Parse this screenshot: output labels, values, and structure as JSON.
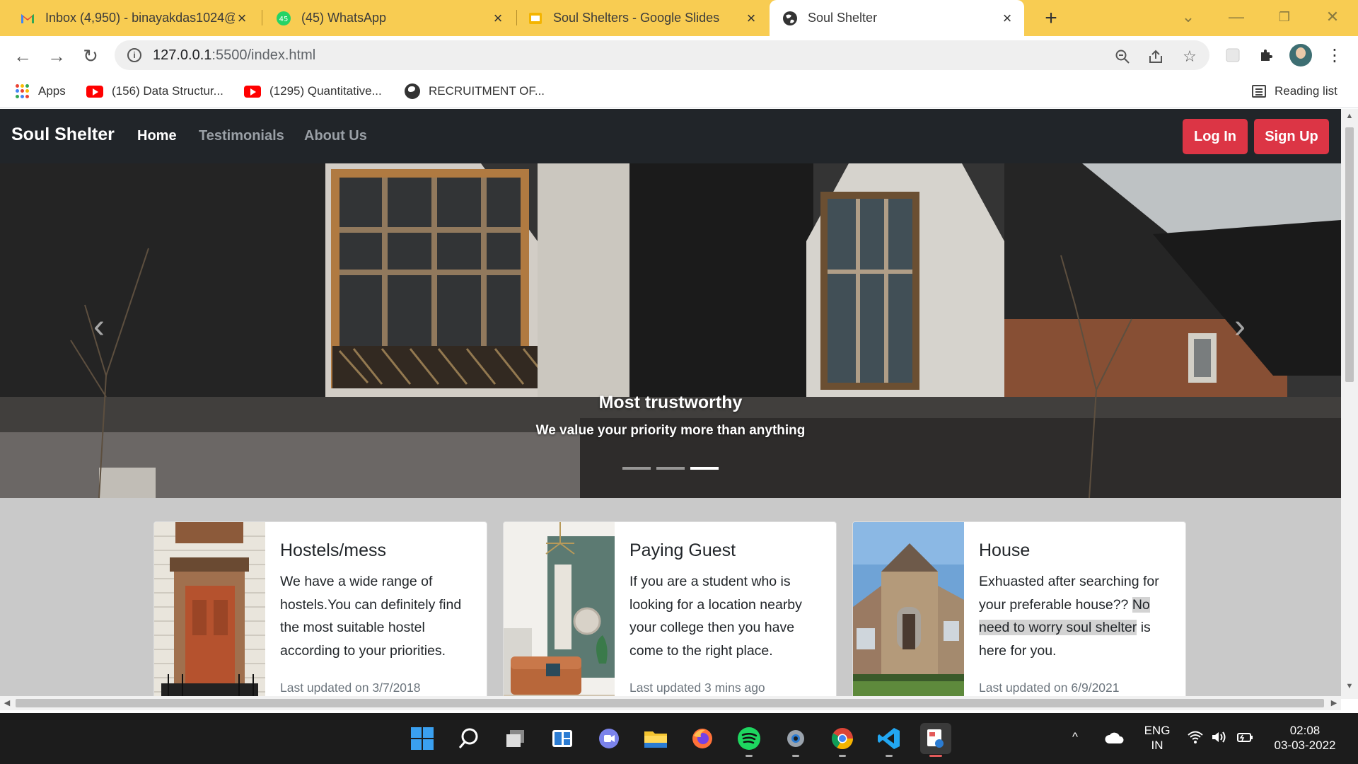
{
  "browser": {
    "tabs": [
      {
        "title": "Inbox (4,950) - binayakdas1024@",
        "icon": "gmail-icon"
      },
      {
        "title": "(45) WhatsApp",
        "icon": "whatsapp-icon",
        "badge": "45"
      },
      {
        "title": "Soul Shelters - Google Slides",
        "icon": "slides-icon"
      },
      {
        "title": "Soul Shelter",
        "icon": "globe-icon",
        "active": true
      }
    ],
    "url_host": "127.0.0.1",
    "url_path": ":5500/index.html",
    "bookmarks": [
      {
        "label": "Apps",
        "icon": "apps-grid-icon"
      },
      {
        "label": "(156) Data Structur...",
        "icon": "youtube-icon"
      },
      {
        "label": "(1295) Quantitative...",
        "icon": "youtube-icon"
      },
      {
        "label": "RECRUITMENT OF...",
        "icon": "globe-icon"
      }
    ],
    "reading_list": "Reading list"
  },
  "site": {
    "brand": "Soul Shelter",
    "nav": [
      "Home",
      "Testimonials",
      "About Us"
    ],
    "login": "Log In",
    "signup": "Sign Up",
    "carousel": {
      "title": "Most trustworthy",
      "subtitle": "We value your priority more than anything",
      "slide_count": 3,
      "active_slide": 3
    },
    "cards": [
      {
        "title": "Hostels/mess",
        "text": "We have a wide range of hostels.You can definitely find the most suitable hostel according to your priorities.",
        "footer": "Last updated on 3/7/2018"
      },
      {
        "title": "Paying Guest",
        "text": "If you are a student who is looking for a location nearby your college then you have come to the right place.",
        "footer": "Last updated 3 mins ago"
      },
      {
        "title": "House",
        "text_before": "Exhuasted after searching for your preferable house?? ",
        "text_highlight": "No need to worry soul shelter",
        "text_after": " is here for you.",
        "footer": "Last updated on 6/9/2021"
      }
    ]
  },
  "taskbar": {
    "lang": "ENG",
    "region": "IN",
    "time": "02:08",
    "date": "03-03-2022"
  },
  "colors": {
    "tabstrip": "#f8cc52",
    "navbar": "#212529",
    "brand_red": "#dc3545"
  }
}
